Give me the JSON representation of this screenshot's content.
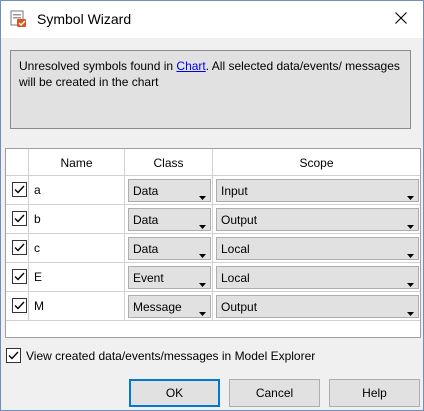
{
  "window": {
    "title": "Symbol Wizard",
    "app_icon": "simulink-symbol-icon",
    "close_icon": "close-icon"
  },
  "info": {
    "text_before": "Unresolved symbols found in ",
    "link": "Chart",
    "text_after": ". All selected data/events/ messages will be created in the chart"
  },
  "table": {
    "columns": [
      "",
      "Name",
      "Class",
      "Scope"
    ],
    "rows": [
      {
        "checked": true,
        "name": "a",
        "class": "Data",
        "scope": "Input"
      },
      {
        "checked": true,
        "name": "b",
        "class": "Data",
        "scope": "Output"
      },
      {
        "checked": true,
        "name": "c",
        "class": "Data",
        "scope": "Local"
      },
      {
        "checked": true,
        "name": "E",
        "class": "Event",
        "scope": "Local"
      },
      {
        "checked": true,
        "name": "M",
        "class": "Message",
        "scope": "Output"
      }
    ]
  },
  "footer": {
    "checkbox_checked": true,
    "checkbox_label": "View created data/events/messages in Model Explorer"
  },
  "buttons": {
    "ok": "OK",
    "cancel": "Cancel",
    "help": "Help"
  },
  "colors": {
    "link": "#0000ee",
    "primary_border": "#0078d7",
    "info_background": "#e1e1e1"
  }
}
